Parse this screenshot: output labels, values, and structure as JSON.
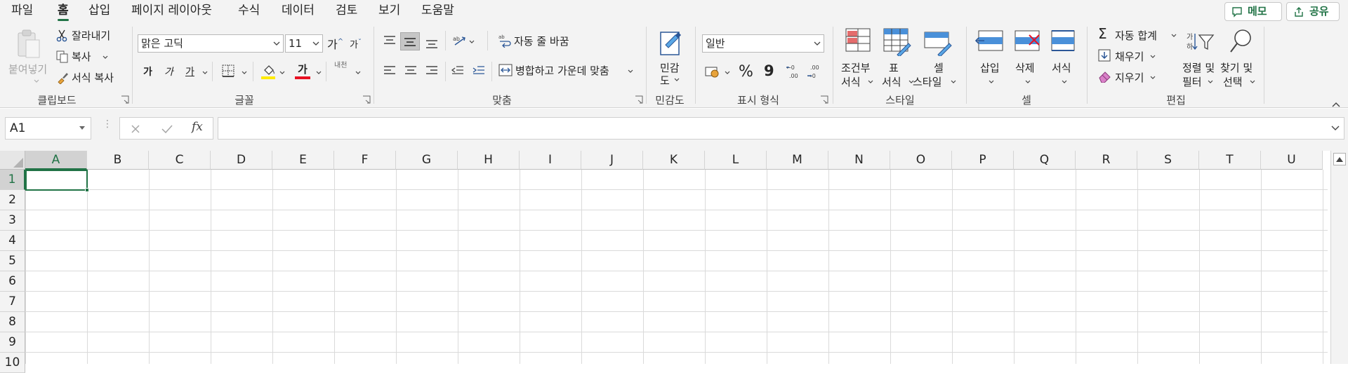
{
  "menu": {
    "tabs": [
      "파일",
      "홈",
      "삽입",
      "페이지 레이아웃",
      "수식",
      "데이터",
      "검토",
      "보기",
      "도움말"
    ],
    "active_tab": "홈",
    "memo_label": "메모",
    "share_label": "공유"
  },
  "ribbon": {
    "clipboard": {
      "paste_label": "붙여넣기",
      "cut_label": "잘라내기",
      "copy_label": "복사",
      "format_painter_label": "서식 복사",
      "group_label": "클립보드"
    },
    "font": {
      "font_name": "맑은 고딕",
      "font_size": "11",
      "grow_label": "가",
      "shrink_label": "가",
      "bold_label": "가",
      "italic_label": "가",
      "underline_label": "가",
      "font_color_label": "가",
      "phonetic_label": "내천",
      "group_label": "글꼴"
    },
    "alignment": {
      "wrap_text_label": "자동 줄 바꿈",
      "merge_center_label": "병합하고 가운데 맞춤",
      "group_label": "맞춤"
    },
    "sensitivity": {
      "label_line1": "민감",
      "label_line2": "도",
      "group_label": "민감도"
    },
    "number": {
      "format_value": "일반",
      "percent_label": "%",
      "comma_label": "9",
      "group_label": "표시 형식"
    },
    "styles": {
      "conditional_line1": "조건부",
      "conditional_line2": "서식",
      "table_line1": "표",
      "table_line2": "서식",
      "cell_style_line1": "셀",
      "cell_style_line2": "스타일",
      "group_label": "스타일"
    },
    "cells": {
      "insert_label": "삽입",
      "delete_label": "삭제",
      "format_label": "서식",
      "group_label": "셀"
    },
    "editing": {
      "autosum_label": "자동 합계",
      "fill_label": "채우기",
      "clear_label": "지우기",
      "sort_line1": "정렬 및",
      "sort_line2": "필터",
      "find_line1": "찾기 및",
      "find_line2": "선택",
      "group_label": "편집"
    }
  },
  "formula_bar": {
    "name_box": "A1",
    "fx_label": "fx",
    "formula": ""
  },
  "sheet": {
    "columns": [
      "A",
      "B",
      "C",
      "D",
      "E",
      "F",
      "G",
      "H",
      "I",
      "J",
      "K",
      "L",
      "M",
      "N",
      "O",
      "P",
      "Q",
      "R",
      "S",
      "T",
      "U"
    ],
    "rows": [
      "1",
      "2",
      "3",
      "4",
      "5",
      "6",
      "7",
      "8",
      "9",
      "10"
    ],
    "selected_cell": "A1",
    "accent": "#217346"
  }
}
